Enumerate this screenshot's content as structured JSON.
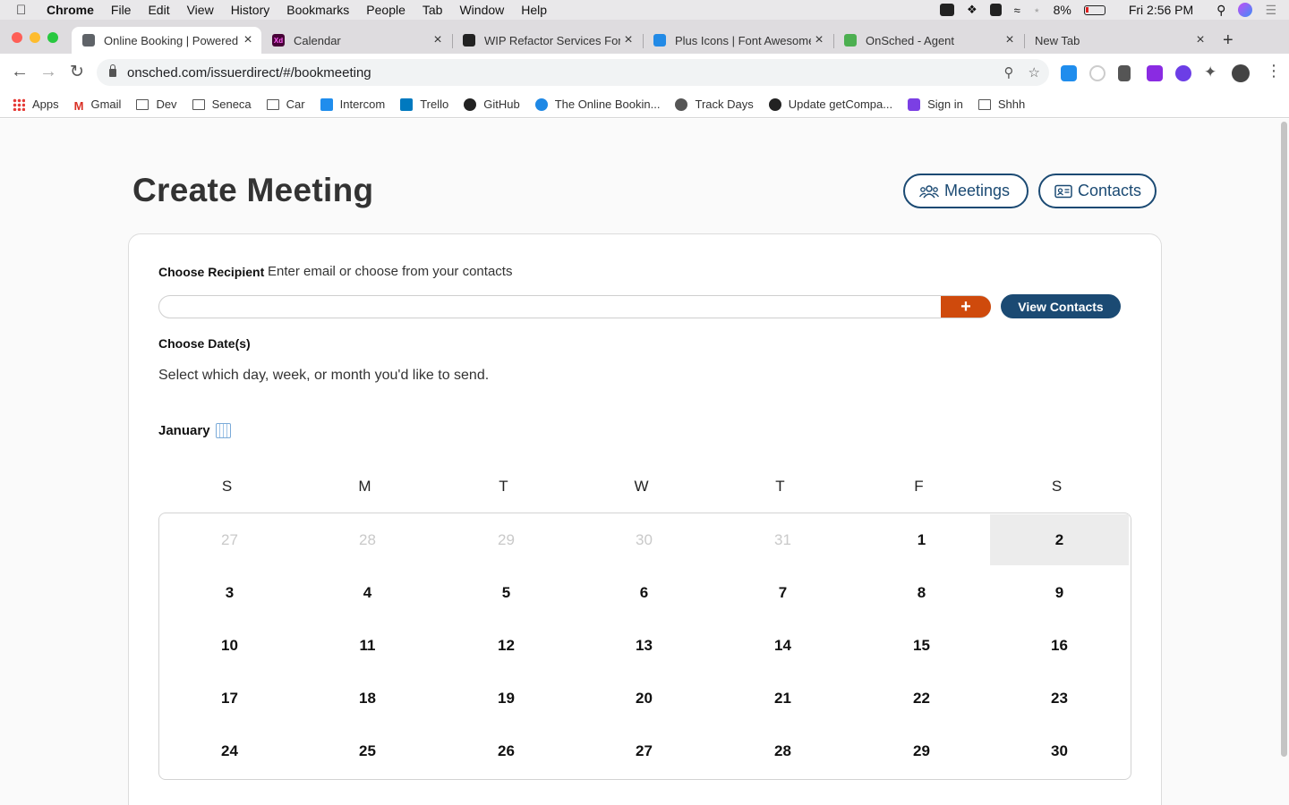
{
  "menubar": {
    "items": [
      "Chrome",
      "File",
      "Edit",
      "View",
      "History",
      "Bookmarks",
      "People",
      "Tab",
      "Window",
      "Help"
    ],
    "battery": "8%",
    "clock": "Fri 2:56 PM"
  },
  "tabs": [
    {
      "title": "Online Booking | Powered",
      "active": true,
      "icon": "globe-icon",
      "color": "#5f6368"
    },
    {
      "title": "Calendar",
      "active": false,
      "icon": "xd-icon",
      "color": "#470137"
    },
    {
      "title": "WIP Refactor Services For",
      "active": false,
      "icon": "github-icon",
      "color": "#222222"
    },
    {
      "title": "Plus Icons | Font Awesome",
      "active": false,
      "icon": "font-awesome-icon",
      "color": "#228ae6"
    },
    {
      "title": "OnSched - Agent",
      "active": false,
      "icon": "onsched-icon",
      "color": "#4caf50"
    },
    {
      "title": "New Tab",
      "active": false,
      "icon": "",
      "color": ""
    }
  ],
  "omnibox": {
    "url": "onsched.com/issuerdirect/#/bookmeeting"
  },
  "bookmarks": [
    {
      "label": "Apps",
      "icon": "apps-grid-icon"
    },
    {
      "label": "Gmail",
      "icon": "gmail-icon"
    },
    {
      "label": "Dev",
      "icon": "folder-icon"
    },
    {
      "label": "Seneca",
      "icon": "folder-icon"
    },
    {
      "label": "Car",
      "icon": "folder-icon"
    },
    {
      "label": "Intercom",
      "icon": "intercom-icon"
    },
    {
      "label": "Trello",
      "icon": "trello-icon"
    },
    {
      "label": "GitHub",
      "icon": "github-icon"
    },
    {
      "label": "The Online Bookin...",
      "icon": "onsched-icon"
    },
    {
      "label": "Track Days",
      "icon": "globe-icon"
    },
    {
      "label": "Update getCompa...",
      "icon": "github-icon"
    },
    {
      "label": "Sign in",
      "icon": "s-icon"
    },
    {
      "label": "Shhh",
      "icon": "folder-icon"
    }
  ],
  "page": {
    "title": "Create Meeting",
    "meetings_button": "Meetings",
    "contacts_button": "Contacts",
    "recipient_label": "Choose Recipient",
    "recipient_hint": "Enter email or choose from your contacts",
    "recipient_value": "",
    "add_button": "+",
    "view_contacts_button": "View Contacts",
    "dates_label": "Choose Date(s)",
    "dates_hint": "Select which day, week, or month you'd like to send.",
    "month": "January"
  },
  "colors": {
    "primary": "#1b4a73",
    "accent": "#cf4a0c"
  },
  "calendar": {
    "weekdays": [
      "S",
      "M",
      "T",
      "W",
      "T",
      "F",
      "S"
    ],
    "weeks": [
      [
        {
          "d": "27",
          "m": true
        },
        {
          "d": "28",
          "m": true
        },
        {
          "d": "29",
          "m": true
        },
        {
          "d": "30",
          "m": true
        },
        {
          "d": "31",
          "m": true
        },
        {
          "d": "1"
        },
        {
          "d": "2",
          "h": true
        }
      ],
      [
        {
          "d": "3"
        },
        {
          "d": "4"
        },
        {
          "d": "5"
        },
        {
          "d": "6"
        },
        {
          "d": "7"
        },
        {
          "d": "8"
        },
        {
          "d": "9"
        }
      ],
      [
        {
          "d": "10"
        },
        {
          "d": "11"
        },
        {
          "d": "12"
        },
        {
          "d": "13"
        },
        {
          "d": "14"
        },
        {
          "d": "15"
        },
        {
          "d": "16"
        }
      ],
      [
        {
          "d": "17"
        },
        {
          "d": "18"
        },
        {
          "d": "19"
        },
        {
          "d": "20"
        },
        {
          "d": "21"
        },
        {
          "d": "22"
        },
        {
          "d": "23"
        }
      ],
      [
        {
          "d": "24"
        },
        {
          "d": "25"
        },
        {
          "d": "26"
        },
        {
          "d": "27"
        },
        {
          "d": "28"
        },
        {
          "d": "29"
        },
        {
          "d": "30"
        }
      ]
    ]
  }
}
